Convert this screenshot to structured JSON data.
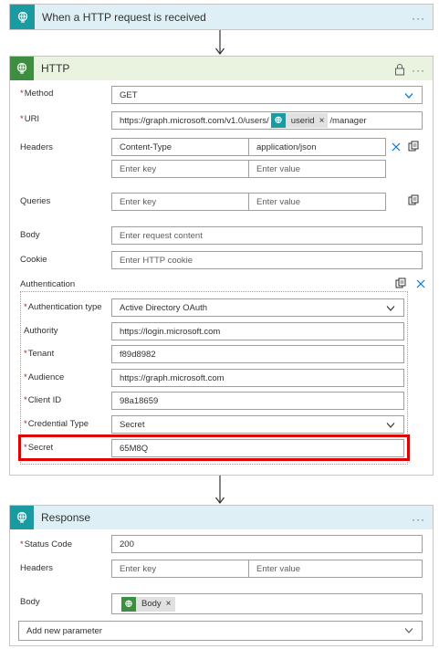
{
  "trigger": {
    "title": "When a HTTP request is received",
    "more": "···"
  },
  "http": {
    "title": "HTTP",
    "more": "···",
    "method": {
      "label": "Method",
      "value": "GET"
    },
    "uri": {
      "label": "URI",
      "prefix": "https://graph.microsoft.com/v1.0/users/",
      "token": "userid",
      "suffix": "/manager"
    },
    "headers": {
      "label": "Headers",
      "rows": [
        {
          "key": "Content-Type",
          "value": "application/json"
        },
        {
          "key": "Enter key",
          "value": "Enter value"
        }
      ]
    },
    "queries": {
      "label": "Queries",
      "key_placeholder": "Enter key",
      "value_placeholder": "Enter value"
    },
    "body": {
      "label": "Body",
      "placeholder": "Enter request content"
    },
    "cookie": {
      "label": "Cookie",
      "placeholder": "Enter HTTP cookie"
    },
    "authentication": {
      "label": "Authentication",
      "type": {
        "label": "Authentication type",
        "value": "Active Directory OAuth"
      },
      "authority": {
        "label": "Authority",
        "value": "https://login.microsoft.com"
      },
      "tenant": {
        "label": "Tenant",
        "value": "f89d8982"
      },
      "audience": {
        "label": "Audience",
        "value": "https://graph.microsoft.com"
      },
      "client_id": {
        "label": "Client ID",
        "value": "98a18659"
      },
      "credential_type": {
        "label": "Credential Type",
        "value": "Secret"
      },
      "secret": {
        "label": "Secret",
        "value": "65M8Q"
      }
    }
  },
  "response": {
    "title": "Response",
    "more": "···",
    "status_code": {
      "label": "Status Code",
      "value": "200"
    },
    "headers": {
      "label": "Headers",
      "key_placeholder": "Enter key",
      "value_placeholder": "Enter value"
    },
    "body": {
      "label": "Body",
      "token": "Body"
    },
    "add_param": "Add new parameter"
  },
  "colors": {
    "required": "#a4262c",
    "highlight": "#e00000",
    "trigger_header": "#def0f6",
    "http_header": "#eaf2e0"
  }
}
